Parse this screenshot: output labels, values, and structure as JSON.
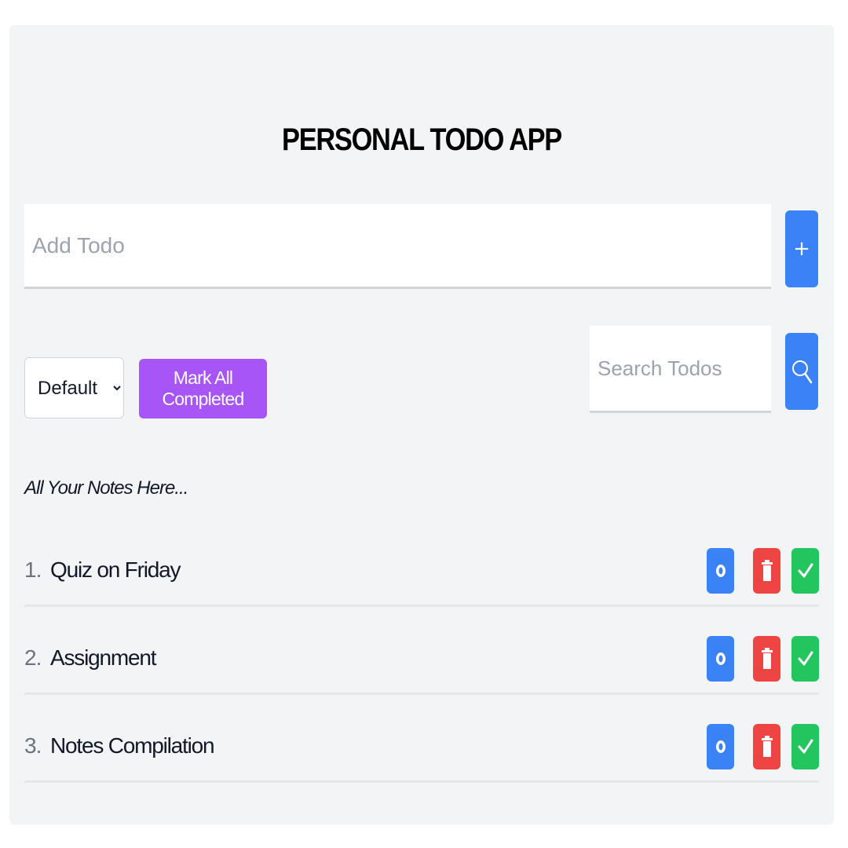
{
  "app": {
    "title": "PERSONAL TODO APP"
  },
  "add_todo": {
    "placeholder": "Add Todo",
    "button_label": "+"
  },
  "controls": {
    "sort_options": [
      "Default"
    ],
    "sort_selected": "Default",
    "mark_all_label": "Mark All Completed",
    "search_placeholder": "Search Todos"
  },
  "notes_label": "All Your Notes Here...",
  "todos": [
    {
      "number": "1.",
      "text": "Quiz on Friday"
    },
    {
      "number": "2.",
      "text": "Assignment"
    },
    {
      "number": "3.",
      "text": "Notes Compilation"
    }
  ],
  "colors": {
    "primary": "#3b82f6",
    "danger": "#ef4444",
    "success": "#22c55e",
    "accent": "#a855f7",
    "background": "#f3f4f6"
  },
  "icons": {
    "add": "plus-icon",
    "search": "search-icon",
    "edit": "edit-icon",
    "delete": "trash-icon",
    "complete": "check-icon"
  }
}
